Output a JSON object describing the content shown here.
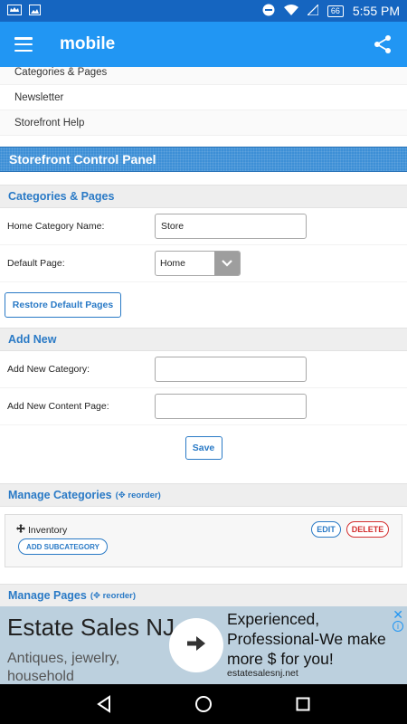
{
  "status_bar": {
    "time": "5:55 PM",
    "battery": "66"
  },
  "app_bar": {
    "title": "mobile"
  },
  "menu": {
    "items": [
      {
        "label": "Categories & Pages"
      },
      {
        "label": "Newsletter"
      },
      {
        "label": "Storefront Help"
      }
    ]
  },
  "panel": {
    "title": "Storefront Control Panel"
  },
  "categories_pages": {
    "title": "Categories & Pages",
    "home_category_label": "Home Category Name:",
    "home_category_value": "Store",
    "default_page_label": "Default Page:",
    "default_page_value": "Home",
    "restore_label": "Restore Default Pages"
  },
  "add_new": {
    "title": "Add New",
    "category_label": "Add New Category:",
    "category_value": "",
    "content_page_label": "Add New Content Page:",
    "content_page_value": "",
    "save_label": "Save"
  },
  "manage_categories": {
    "title": "Manage Categories",
    "reorder_label": "(✥ reorder)",
    "items": [
      {
        "name": "Inventory",
        "edit": "EDIT",
        "delete": "DELETE",
        "add_sub": "ADD SUBCATEGORY"
      }
    ]
  },
  "manage_pages": {
    "title": "Manage Pages",
    "reorder_label": "(✥ reorder)"
  },
  "ad": {
    "title": "Estate Sales NJ",
    "subtitle": "Antiques, jewelry, household",
    "headline": "Experienced, Professional-We make more $ for you!",
    "domain": "estatesalesnj.net",
    "close": "✕",
    "info": "i"
  },
  "colors": {
    "app_bar": "#2196f3",
    "status_bar": "#1565c0",
    "accent": "#2a7ac6",
    "delete": "#d32f2f",
    "ad_bg": "#bcd0de"
  }
}
